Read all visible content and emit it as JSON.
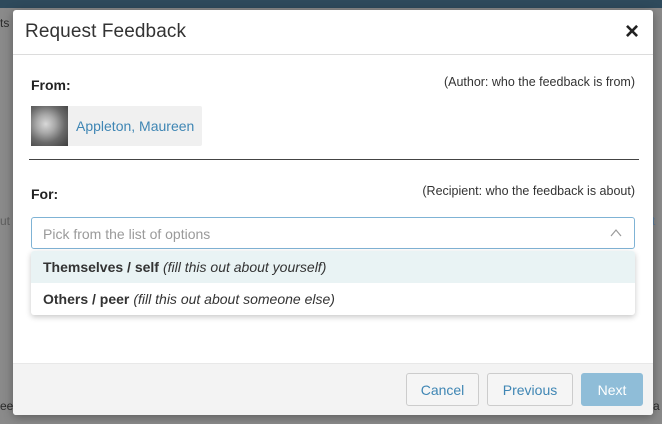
{
  "background": {
    "left_edge_top": "ts",
    "left_edge_mid": "ut",
    "left_edge_bottom": "ee",
    "right_edge_mid": "t",
    "right_edge_bottom": "a"
  },
  "modal": {
    "title": "Request Feedback",
    "close_symbol": "×",
    "from": {
      "label": "From:",
      "hint": "(Author: who the feedback is from)",
      "author_name": "Appleton, Maureen"
    },
    "for": {
      "label": "For:",
      "hint": "(Recipient: who the feedback is about)",
      "placeholder": "Pick from the list of options",
      "options": [
        {
          "main": "Themselves / self",
          "note": "(fill this out about yourself)"
        },
        {
          "main": "Others / peer",
          "note": "(fill this out about someone else)"
        }
      ]
    },
    "footer": {
      "cancel_label": "Cancel",
      "previous_label": "Previous",
      "next_label": "Next"
    }
  },
  "colors": {
    "accent": "#3f86b4",
    "next_button": "#8fbdd8",
    "option_highlight": "#e9f3f4"
  },
  "icons": [
    "close-icon",
    "chevron-up-icon"
  ]
}
